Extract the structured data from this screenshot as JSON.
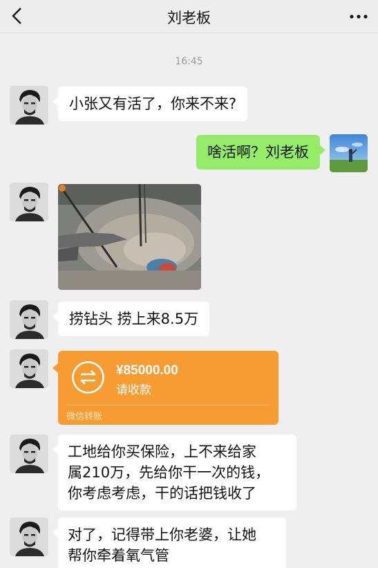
{
  "header": {
    "title": "刘老板",
    "back_icon": "chevron-left-icon",
    "more_icon": "more-dots-icon"
  },
  "timestamp": "16:45",
  "messages": [
    {
      "from": "other",
      "type": "text",
      "text": "小张又有活了，你来不来?"
    },
    {
      "from": "me",
      "type": "text",
      "text": "啥活啊？刘老板"
    },
    {
      "from": "other",
      "type": "image",
      "image_content": "drill-site-photo"
    },
    {
      "from": "other",
      "type": "text",
      "text": "捞钻头 捞上来8.5万"
    },
    {
      "from": "other",
      "type": "transfer",
      "amount": "¥85000.00",
      "note": "请收款",
      "footer": "微信转账",
      "color": "#f79c32"
    },
    {
      "from": "other",
      "type": "text",
      "lines": [
        "工地给你买保险，上不来给家",
        "属210万，先给你干一次的钱，",
        "你考虑考虑，干的话把钱收了"
      ]
    },
    {
      "from": "other",
      "type": "text",
      "lines": [
        "对了，记得带上你老婆，让她",
        "帮你牵着氧气管"
      ]
    }
  ],
  "colors": {
    "background": "#efefef",
    "my_bubble": "#95ec69",
    "other_bubble": "#ffffff",
    "transfer": "#f79c32"
  }
}
